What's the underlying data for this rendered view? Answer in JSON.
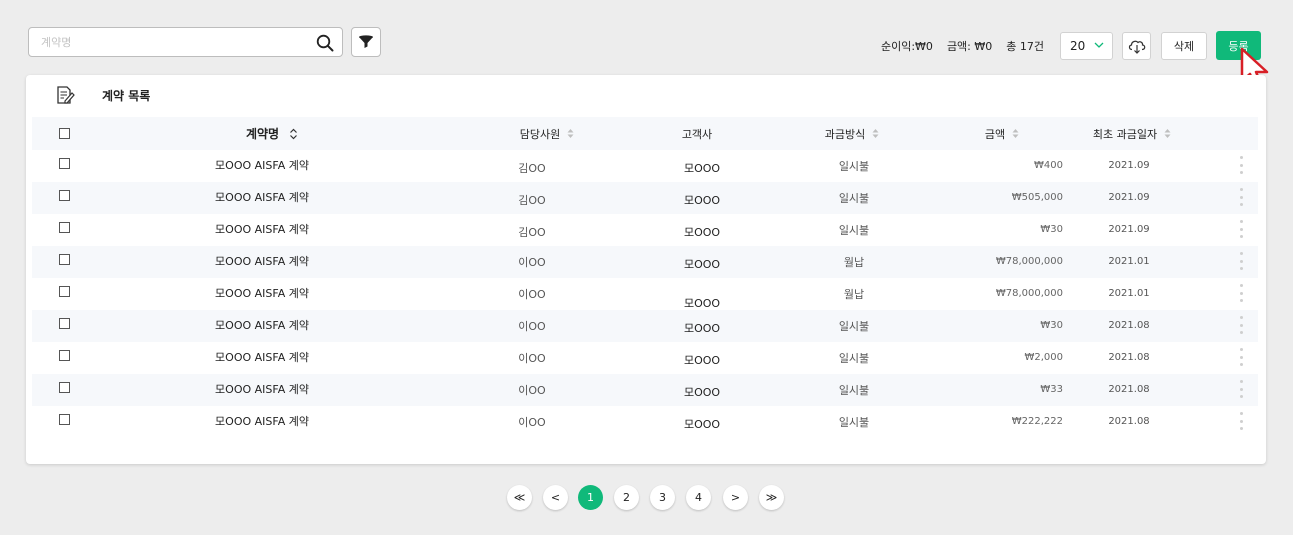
{
  "search": {
    "placeholder": "계약명",
    "value": ""
  },
  "summary": {
    "net_profit": "순이익:₩0",
    "amount": "금액: ₩0",
    "total": "총 17건"
  },
  "page_size": {
    "selected": "20"
  },
  "buttons": {
    "delete": "삭제",
    "register": "등록"
  },
  "list": {
    "title": "계약 목록",
    "columns": {
      "name": "계약명",
      "manager": "담당사원",
      "client": "고객사",
      "billing": "과금방식",
      "amount": "금액",
      "first_billing_date": "최초 과금일자"
    },
    "rows": [
      {
        "name": "모OOO AISFA 계약",
        "manager": "김OO",
        "client": "모OOO",
        "billing": "일시불",
        "amount": "₩400",
        "date": "2021.09"
      },
      {
        "name": "모OOO AISFA 계약",
        "manager": "김OO",
        "client": "모OOO",
        "billing": "일시불",
        "amount": "₩505,000",
        "date": "2021.09"
      },
      {
        "name": "모OOO AISFA 계약",
        "manager": "김OO",
        "client": "모OOO",
        "billing": "일시불",
        "amount": "₩30",
        "date": "2021.09"
      },
      {
        "name": "모OOO AISFA 계약",
        "manager": "이OO",
        "client": "모OOO",
        "billing": "월납",
        "amount": "₩78,000,000",
        "date": "2021.01"
      },
      {
        "name": "모OOO AISFA 계약",
        "manager": "이OO",
        "client": "모OOO",
        "billing": "월납",
        "amount": "₩78,000,000",
        "date": "2021.01"
      },
      {
        "name": "모OOO AISFA 계약",
        "manager": "이OO",
        "client": "모OOO",
        "billing": "일시불",
        "amount": "₩30",
        "date": "2021.08"
      },
      {
        "name": "모OOO AISFA 계약",
        "manager": "이OO",
        "client": "모OOO",
        "billing": "일시불",
        "amount": "₩2,000",
        "date": "2021.08"
      },
      {
        "name": "모OOO AISFA 계약",
        "manager": "이OO",
        "client": "모OOO",
        "billing": "일시불",
        "amount": "₩33",
        "date": "2021.08"
      },
      {
        "name": "모OOO AISFA 계약",
        "manager": "이OO",
        "client": "모OOO",
        "billing": "일시불",
        "amount": "₩222,222",
        "date": "2021.08"
      }
    ]
  },
  "pagination": {
    "first": "≪",
    "prev": "<",
    "pages": [
      "1",
      "2",
      "3",
      "4"
    ],
    "current": "1",
    "next": ">",
    "last": "≫"
  },
  "colors": {
    "accent": "#10b97a",
    "background": "#ededed",
    "header_bg": "#f6f8fb"
  }
}
